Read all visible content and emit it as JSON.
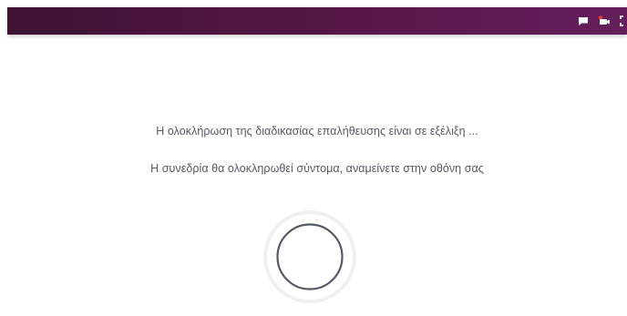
{
  "header": {
    "background_color": "#521743",
    "icons": [
      "chat-icon",
      "camera-icon",
      "fullscreen-icon"
    ]
  },
  "status": {
    "line1": "Η ολοκλήρωση της διαδικασίας επαλήθευσης είναι σε εξέλιξη ...",
    "line2": "Η συνεδρία θα ολοκληρωθεί σύντομα, αναμείνετε στην οθόνη σας"
  },
  "spinner": {
    "icon": "loading-spinner-icon",
    "ring_color": "#555a64",
    "halo_color": "#f0f0f0"
  }
}
